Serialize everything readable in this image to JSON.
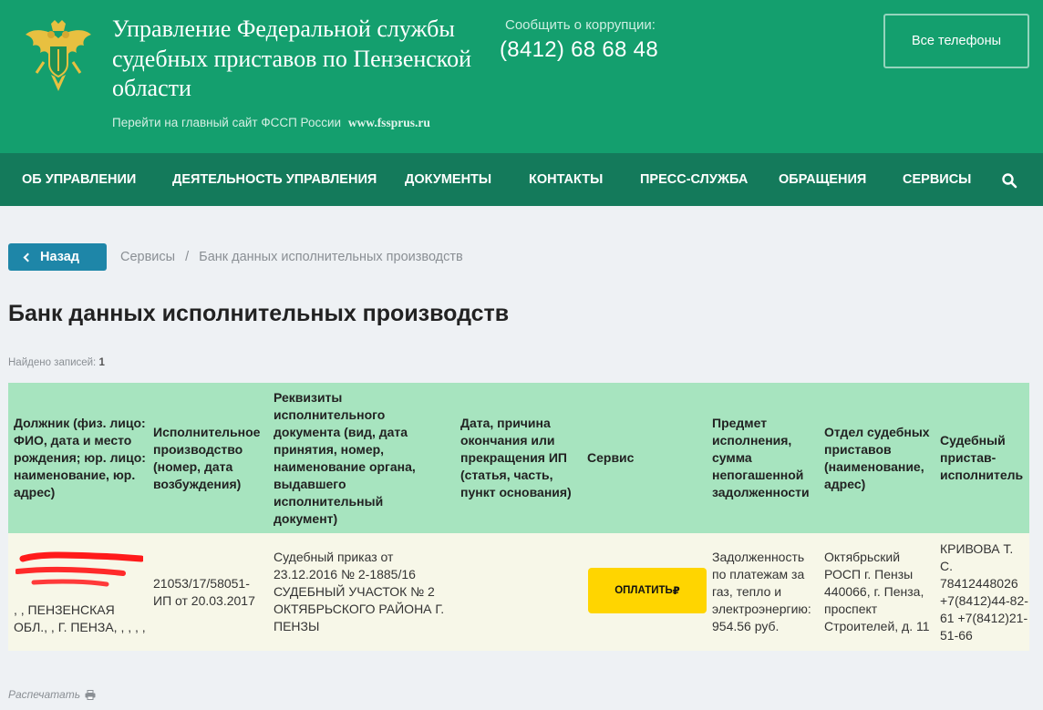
{
  "header": {
    "org_title": "Управление Федеральной службы судебных приставов по Пензенской области",
    "main_site_text": "Перейти на главный сайт ФССП России",
    "main_site_url": "www.fssprus.ru",
    "corruption_label": "Сообщить о коррупции:",
    "corruption_phone": "(8412) 68 68 48",
    "all_phones_label": "Все телефоны"
  },
  "nav": {
    "items": [
      {
        "label": "ОБ УПРАВЛЕНИИ"
      },
      {
        "label": "ДЕЯТЕЛЬНОСТЬ УПРАВЛЕНИЯ"
      },
      {
        "label": "ДОКУМЕНТЫ"
      },
      {
        "label": "КОНТАКТЫ"
      },
      {
        "label": "ПРЕСС-СЛУЖБА"
      },
      {
        "label": "ОБРАЩЕНИЯ"
      },
      {
        "label": "СЕРВИСЫ"
      }
    ],
    "search_icon": "search-icon"
  },
  "breadcrumb": {
    "back_label": "Назад",
    "items": [
      "Сервисы",
      "Банк данных исполнительных производств"
    ],
    "separator": "/"
  },
  "page_title": "Банк данных исполнительных производств",
  "found": {
    "label": "Найдено записей:",
    "count": "1"
  },
  "table": {
    "headers": [
      "Должник (физ. лицо: ФИО, дата и место рождения; юр. лицо: наименование, юр. адрес)",
      "Исполнительное производство (номер, дата возбуждения)",
      "Реквизиты исполнительного документа (вид, дата принятия, номер, наименование органа, выдавшего исполнительный документ)",
      "Дата, причина окончания или прекращения ИП (статья, часть, пункт основания)",
      "Сервис",
      "Предмет исполнения, сумма непогашенной задолженности",
      "Отдел судебных приставов (наименование, адрес)",
      "Судебный пристав-исполнитель"
    ],
    "rows": [
      {
        "debtor": ", , ПЕНЗЕНСКАЯ ОБЛ., , Г. ПЕНЗА, , , , ,",
        "proceeding": "21053/17/58051-ИП от 20.03.2017",
        "document": "Судебный приказ от 23.12.2016 № 2-1885/16 СУДЕБНЫЙ УЧАСТОК № 2 ОКТЯБРЬСКОГО РАЙОНА Г. ПЕНЗЫ",
        "end_reason": "",
        "pay_label": "ОПЛАТИТЬ",
        "pay_currency": "₽",
        "subject": "Задолженность по платежам за газ, тепло и электроэнергию: 954.56 руб.",
        "department": "Октябрьский РОСП г. Пензы 440066, г. Пенза, проспект Строителей, д. 11",
        "bailiff": "КРИВОВА Т. С. 78412448026 +7(8412)44-82-61 +7(8412)21-51-66"
      }
    ]
  },
  "print_label": "Распечатать",
  "colors": {
    "header_bg": "#149f6e",
    "nav_bg": "#147a5b",
    "table_head_bg": "#a7e4bf",
    "table_row_bg": "#f7f7e8",
    "pay_button": "#ffd500",
    "back_button": "#1e86a8"
  }
}
